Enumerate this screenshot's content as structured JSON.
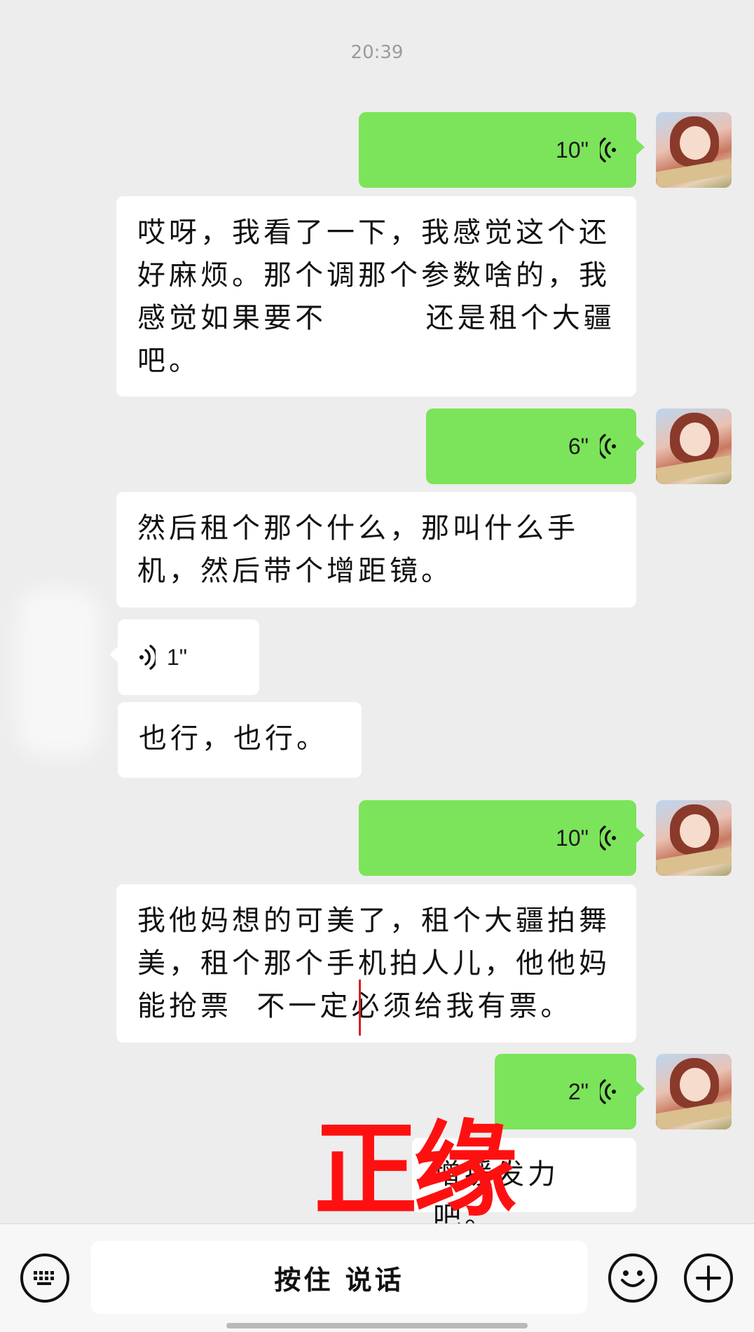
{
  "chat": {
    "timestamp": "20:39",
    "messages": [
      {
        "side": "out",
        "type": "voice",
        "duration": "10\""
      },
      {
        "side": "in",
        "type": "text",
        "text": "哎呀，我看了一下，我感觉这个还好麻烦。那个调那个参数啥的，我感觉如果要不        还是租个大疆吧。"
      },
      {
        "side": "out",
        "type": "voice",
        "duration": "6\""
      },
      {
        "side": "in",
        "type": "text",
        "text": "然后租个那个什么，那叫什么手机，然后带个增距镜。"
      },
      {
        "side": "in",
        "type": "voice",
        "duration": "1\""
      },
      {
        "side": "in",
        "type": "text",
        "text": "也行，也行。"
      },
      {
        "side": "out",
        "type": "voice",
        "duration": "10\""
      },
      {
        "side": "in",
        "type": "text",
        "text": "我他妈想的可美了，租个大疆拍舞美，租个那个手机拍人儿，他他妈能抢票  不一定必须给我有票。"
      },
      {
        "side": "out",
        "type": "voice",
        "duration": "2\""
      },
      {
        "side": "in",
        "type": "text",
        "text": "增援发力吧。"
      }
    ]
  },
  "watermark": {
    "text": "正缘",
    "color": "#ff1010"
  },
  "toolbar": {
    "keyboard_icon": "keyboard-icon",
    "hold_to_talk_label": "按住 说话",
    "emoji_icon": "emoji-icon",
    "plus_icon": "plus-icon"
  },
  "colors": {
    "outgoing_bubble": "#7be45a",
    "incoming_bubble": "#ffffff",
    "background": "#ededed"
  }
}
